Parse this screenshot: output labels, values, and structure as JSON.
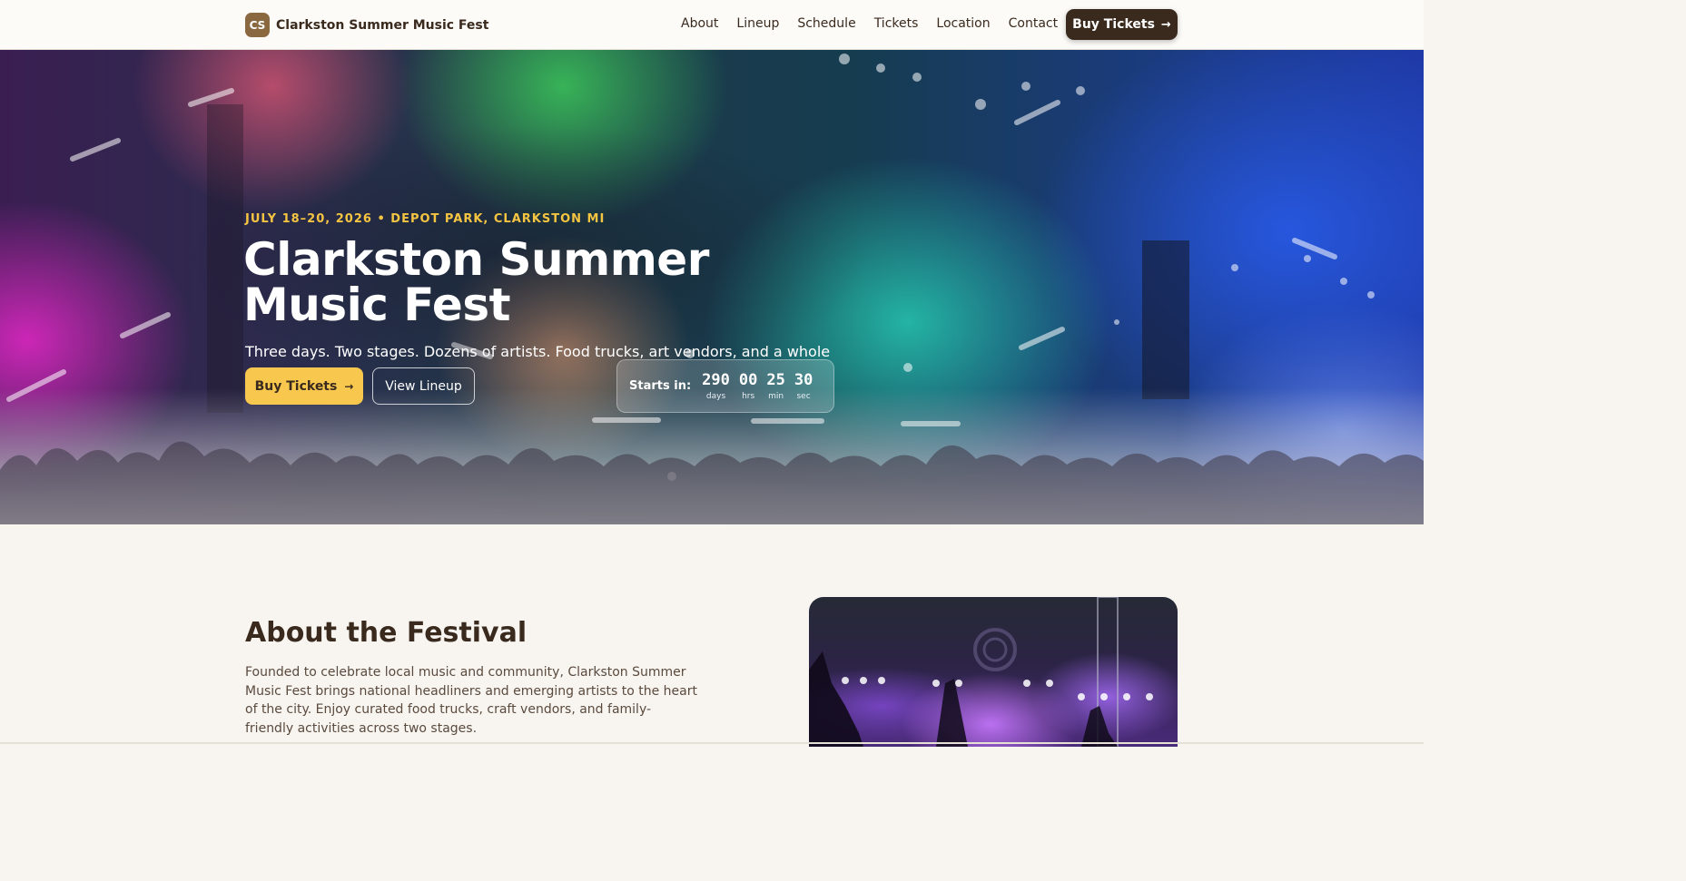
{
  "nav": {
    "brand_badge": "CS",
    "brand_name": "Clarkston Summer Music Fest",
    "links": [
      "About",
      "Lineup",
      "Schedule",
      "Tickets",
      "Location",
      "Contact"
    ],
    "cta_label": "Buy Tickets",
    "cta_arrow": "→"
  },
  "hero": {
    "date_location": "JULY 18–20, 2026 • DEPOT PARK, CLARKSTON MI",
    "title": "Clarkston Summer Music Fest",
    "subtitle": "Three days. Two stages. Dozens of artists. Food trucks, art vendors, and a whole summer vibe.",
    "primary_button": "Buy Tickets",
    "primary_arrow": "→",
    "secondary_button": "View Lineup",
    "countdown": {
      "label": "Starts in:",
      "units": [
        {
          "value": "290",
          "unit": "days"
        },
        {
          "value": "00",
          "unit": "hrs"
        },
        {
          "value": "25",
          "unit": "min"
        },
        {
          "value": "30",
          "unit": "sec"
        }
      ]
    }
  },
  "about": {
    "title": "About the Festival",
    "text": "Founded to celebrate local music and community, Clarkston Summer Music Fest brings national headliners and emerging artists to the heart of the city. Enjoy curated food trucks, craft vendors, and family-friendly activities across two stages."
  },
  "colors": {
    "brand_dark": "#3a2a1e",
    "accent_yellow": "#f7c84d",
    "date_yellow": "#f5c542",
    "badge_brown": "#8a6840",
    "page_bg": "#f8f5f0"
  }
}
